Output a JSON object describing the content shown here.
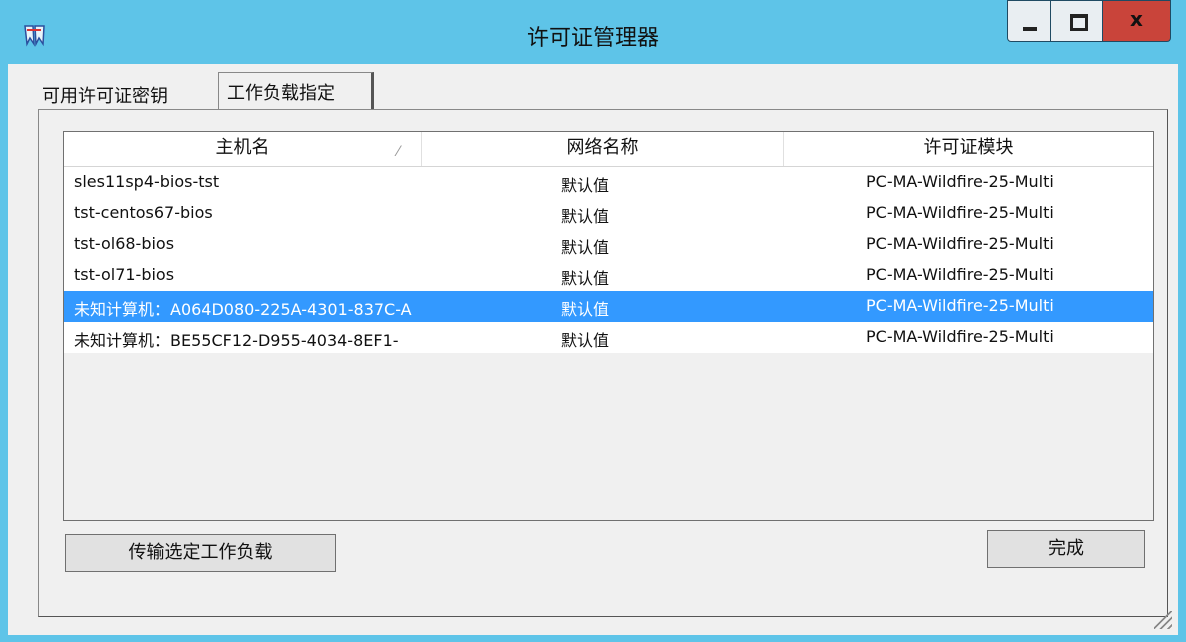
{
  "window": {
    "title": "许可证管理器",
    "close_label": "x"
  },
  "tabs": [
    {
      "label": "可用许可证密钥",
      "active": false
    },
    {
      "label": "工作负载指定",
      "active": true
    }
  ],
  "table": {
    "columns": [
      "主机名",
      "网络名称",
      "许可证模块"
    ],
    "sort_indicator": "⁄",
    "rows": [
      {
        "host": "sles11sp4-bios-tst",
        "network": "默认值",
        "module": "PC-MA-Wildfire-25-Multi",
        "selected": false
      },
      {
        "host": "tst-centos67-bios",
        "network": "默认值",
        "module": "PC-MA-Wildfire-25-Multi",
        "selected": false
      },
      {
        "host": "tst-ol68-bios",
        "network": "默认值",
        "module": "PC-MA-Wildfire-25-Multi",
        "selected": false
      },
      {
        "host": "tst-ol71-bios",
        "network": "默认值",
        "module": "PC-MA-Wildfire-25-Multi",
        "selected": false
      },
      {
        "host": "未知计算机：A064D080-225A-4301-837C-A",
        "network": "默认值",
        "module": "PC-MA-Wildfire-25-Multi",
        "selected": true
      },
      {
        "host": "未知计算机：BE55CF12-D955-4034-8EF1-",
        "network": "默认值",
        "module": "PC-MA-Wildfire-25-Multi",
        "selected": false
      }
    ]
  },
  "buttons": {
    "transfer": "传输选定工作负载",
    "done": "完成"
  },
  "colors": {
    "title_bar": "#5ec4e8",
    "selection": "#3399ff",
    "close_button": "#c9443a"
  }
}
